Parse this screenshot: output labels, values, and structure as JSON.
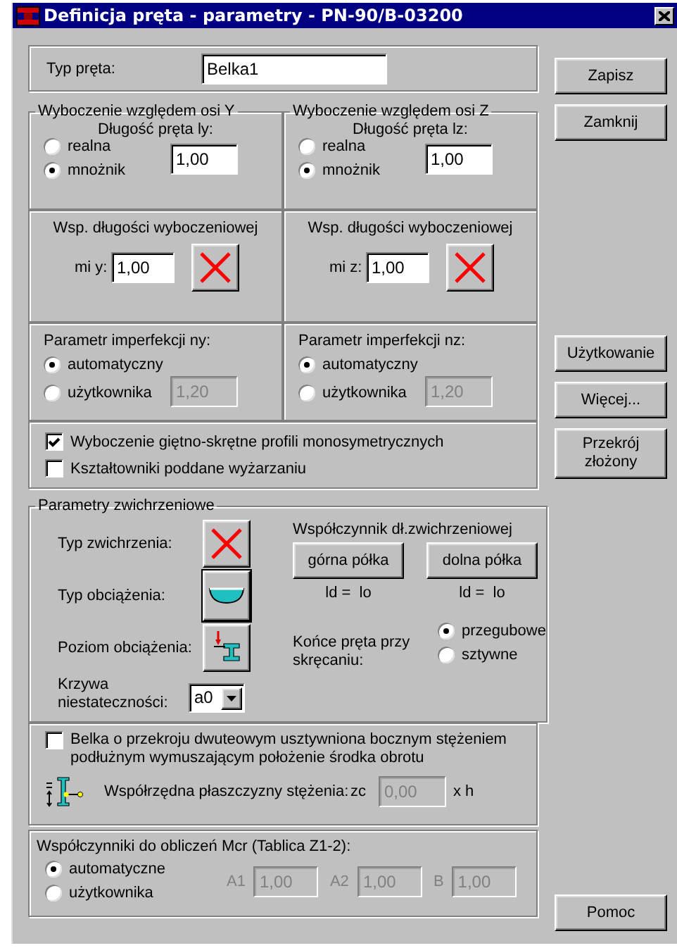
{
  "window": {
    "title": "Definicja pręta - parametry - PN-90/B-03200"
  },
  "member_type": {
    "label": "Typ pręta:",
    "value": "Belka1"
  },
  "buckling": [
    {
      "title": "Wyboczenie względem osi Y",
      "length_label": "Długość pręta ly:",
      "length_options": [
        {
          "label": "realna",
          "selected": false
        },
        {
          "label": "mnożnik",
          "selected": true
        }
      ],
      "length_value": "1,00",
      "coef_title": "Wsp. długości wyboczeniowej",
      "coef_label": "mi y:",
      "coef_value": "1,00",
      "imperf_title": "Parametr imperfekcji ny:",
      "imperf_options": [
        {
          "label": "automatyczny",
          "selected": true
        },
        {
          "label": "użytkownika",
          "selected": false
        }
      ],
      "imperf_value": "1,20",
      "imperf_disabled": true
    },
    {
      "title": "Wyboczenie względem osi Z",
      "length_label": "Długość pręta lz:",
      "length_options": [
        {
          "label": "realna",
          "selected": false
        },
        {
          "label": "mnożnik",
          "selected": true
        }
      ],
      "length_value": "1,00",
      "coef_title": "Wsp. długości wyboczeniowej",
      "coef_label": "mi z:",
      "coef_value": "1,00",
      "imperf_title": "Parametr imperfekcji nz:",
      "imperf_options": [
        {
          "label": "automatyczny",
          "selected": true
        },
        {
          "label": "użytkownika",
          "selected": false
        }
      ],
      "imperf_value": "1,20",
      "imperf_disabled": true
    }
  ],
  "checkboxes": [
    {
      "label": "Wyboczenie giętno-skrętne profili monosymetrycznych",
      "checked": true
    },
    {
      "label": "Kształtowniki poddane wyżarzaniu",
      "checked": false
    }
  ],
  "lateral": {
    "title": "Parametry zwichrzeniowe",
    "rows": [
      {
        "label": "Typ zwichrzenia:",
        "kind": "cross"
      },
      {
        "label": "Typ obciążenia:",
        "kind": "load"
      },
      {
        "label": "Poziom obciążenia:",
        "kind": "level"
      }
    ],
    "coef_title": "Współczynnik dł.zwichrzeniowej",
    "flange_buttons": [
      {
        "label": "górna półka",
        "formula": "ld =  lo"
      },
      {
        "label": "dolna półka",
        "formula": "ld =  lo"
      }
    ],
    "curve": {
      "label": "Krzywa niestateczności:",
      "value": "a0"
    },
    "ends": {
      "label": "Końce pręta przy skręcaniu:",
      "options": [
        {
          "label": "przegubowe",
          "selected": true
        },
        {
          "label": "sztywne",
          "selected": false
        }
      ]
    }
  },
  "bracing": {
    "label": "Belka o przekroju dwuteowym usztywniona bocznym stężeniem podłużnym wymuszającym położenie środka obrotu",
    "checked": false,
    "coord_label": "Współrzędna płaszczyzny stężenia:",
    "symbol": "zc",
    "value": "0,00",
    "disabled": true,
    "unit": "x h"
  },
  "mcr": {
    "title": "Współczynniki do obliczeń Mcr (Tablica Z1-2):",
    "options": [
      {
        "label": "automatyczne",
        "selected": true
      },
      {
        "label": "użytkownika",
        "selected": false
      }
    ],
    "fields": [
      {
        "label": "A1",
        "value": "1,00",
        "disabled": true
      },
      {
        "label": "A2",
        "value": "1,00",
        "disabled": true
      },
      {
        "label": "B",
        "value": "1,00",
        "disabled": true
      }
    ]
  },
  "side_buttons": [
    [
      {
        "label": "Zapisz"
      },
      {
        "label": "Zamknij"
      }
    ],
    [
      {
        "label": "Użytkowanie"
      },
      {
        "label": "Więcej..."
      },
      {
        "label": "Przekrój złożony"
      }
    ],
    [
      {
        "label": "Pomoc"
      }
    ]
  ]
}
